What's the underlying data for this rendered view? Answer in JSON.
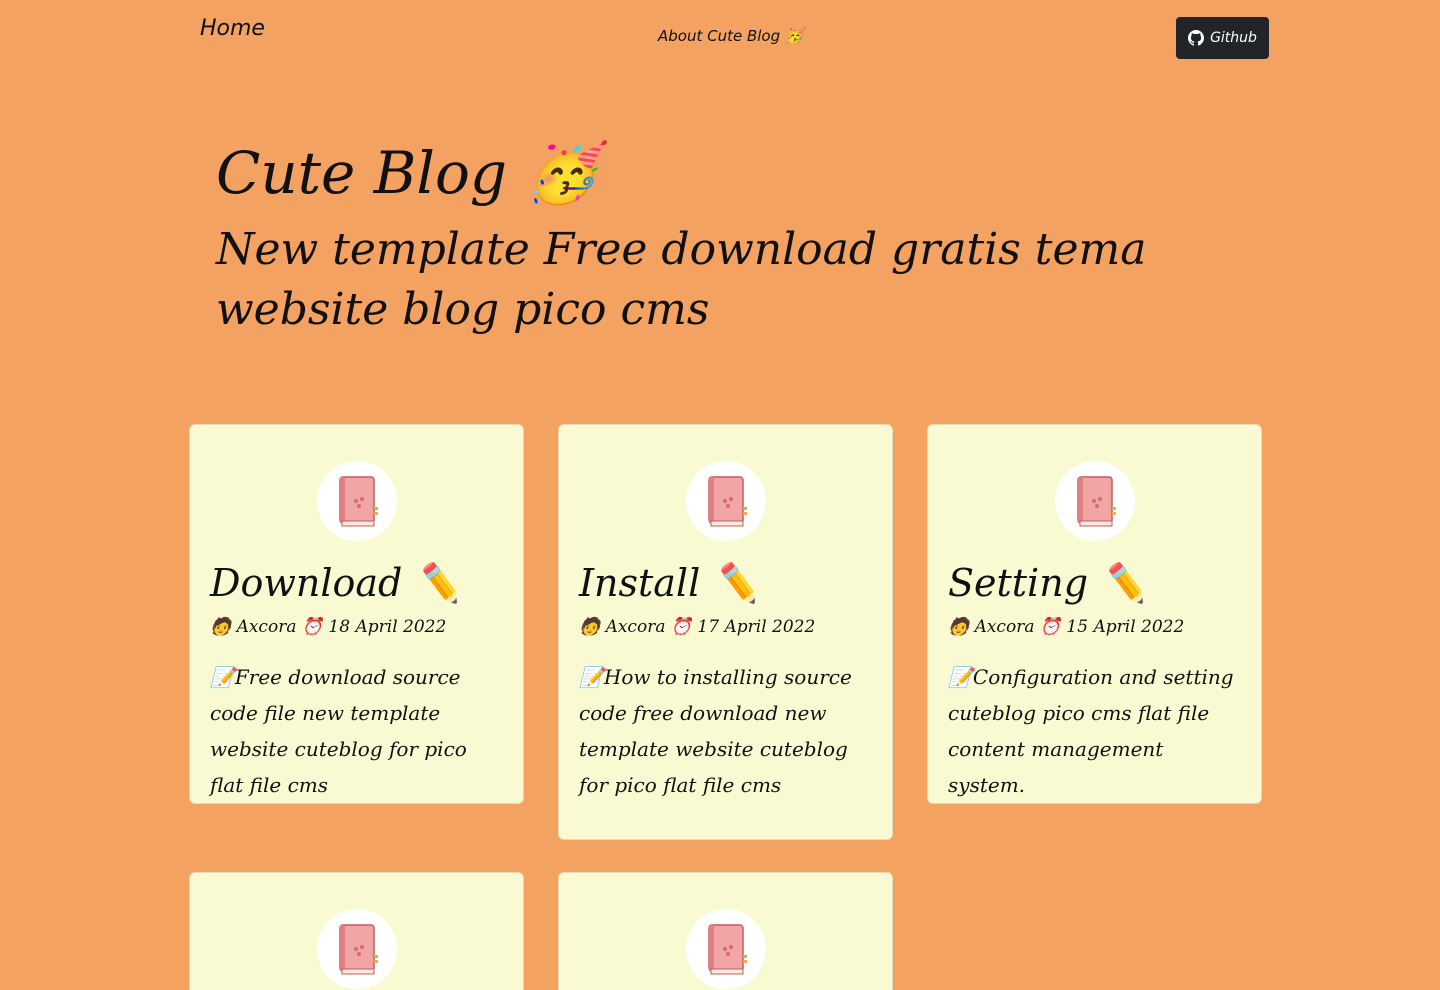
{
  "nav": {
    "home": "Home",
    "about": "About Cute Blog 🥳",
    "github": "Github"
  },
  "hero": {
    "title": "Cute Blog 🥳",
    "subtitle": "New template Free download gratis tema website blog pico cms"
  },
  "posts": [
    {
      "title": "Download ✏️",
      "author": "🧑 Axcora",
      "date": "⏰ 18 April 2022",
      "desc": "📝Free download source code file new template website cuteblog for pico flat file cms"
    },
    {
      "title": "Install ✏️",
      "author": "🧑 Axcora",
      "date": "⏰ 17 April 2022",
      "desc": "📝How to installing source code free download new template website cuteblog for pico flat file cms"
    },
    {
      "title": "Setting ✏️",
      "author": "🧑 Axcora",
      "date": "⏰ 15 April 2022",
      "desc": "📝Configuration and setting cuteblog pico cms flat file content management system."
    },
    {
      "image_icon": "diary-book-icon"
    },
    {
      "image_icon": "diary-book-icon"
    }
  ],
  "colors": {
    "background": "#f4a261",
    "card": "#fafad2",
    "button": "#212529"
  }
}
